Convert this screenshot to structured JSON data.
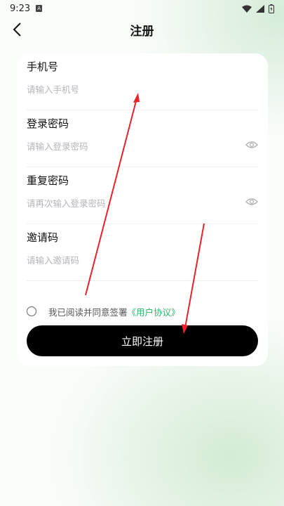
{
  "status_bar": {
    "time": "9:23",
    "sim_glyph": "A"
  },
  "header": {
    "title": "注册"
  },
  "form": {
    "fields": [
      {
        "label": "手机号",
        "placeholder": "请输入手机号"
      },
      {
        "label": "登录密码",
        "placeholder": "请输入登录密码"
      },
      {
        "label": "重复密码",
        "placeholder": "请再次输入登录密码"
      },
      {
        "label": "邀请码",
        "placeholder": "请输入邀请码"
      }
    ],
    "agreement_text": "我已阅读并同意签署",
    "agreement_link": "《用户协议》",
    "submit_label": "立即注册"
  },
  "colors": {
    "accent": "#2fb36b",
    "button": "#000000",
    "annotation_arrow": "#e8222a"
  }
}
